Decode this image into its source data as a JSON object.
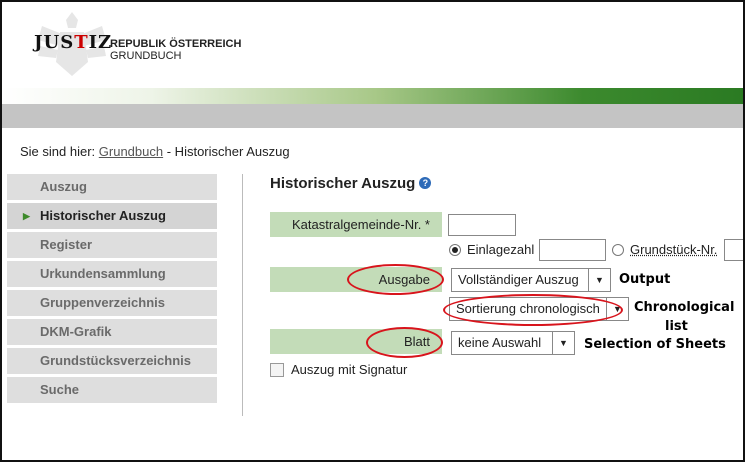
{
  "header": {
    "logo_text_1": "JUS",
    "logo_text_i": "T",
    "logo_text_2": "IZ",
    "brand_line1": "REPUBLIK ÖSTERREICH",
    "brand_line2": "GRUNDBUCH"
  },
  "breadcrumb": {
    "prefix": "Sie sind hier:",
    "link": "Grundbuch",
    "current": "- Historischer Auszug"
  },
  "sidebar": {
    "items": [
      {
        "label": "Auszug",
        "active": false
      },
      {
        "label": "Historischer Auszug",
        "active": true
      },
      {
        "label": "Register",
        "active": false
      },
      {
        "label": "Urkundensammlung",
        "active": false
      },
      {
        "label": "Gruppenverzeichnis",
        "active": false
      },
      {
        "label": "DKM-Grafik",
        "active": false
      },
      {
        "label": "Grundstücksverzeichnis",
        "active": false
      },
      {
        "label": "Suche",
        "active": false
      }
    ]
  },
  "main": {
    "title": "Historischer Auszug",
    "help_icon": "?",
    "kg_label": "Katastralgemeinde-Nr. *",
    "kg_value": "",
    "radio_einlagezahl": "Einlagezahl",
    "einlagezahl_value": "",
    "radio_grundstueck": "Grundstück-Nr.",
    "ausgabe_label": "Ausgabe",
    "ausgabe_value": "Vollständiger Auszug",
    "sortierung_value": "Sortierung chronologisch",
    "blatt_label": "Blatt",
    "blatt_value": "keine Auswahl",
    "signatur_label": "Auszug mit Signatur"
  },
  "annotations": {
    "output": "Output",
    "chronological_1": "Chronological",
    "chronological_2": "list",
    "sheets": "Selection of Sheets"
  },
  "colors": {
    "label_bg": "#c3dcb8",
    "accent_green": "#3c8a2e",
    "annotation_red": "#d8141c",
    "help_blue": "#2e6bb8"
  }
}
